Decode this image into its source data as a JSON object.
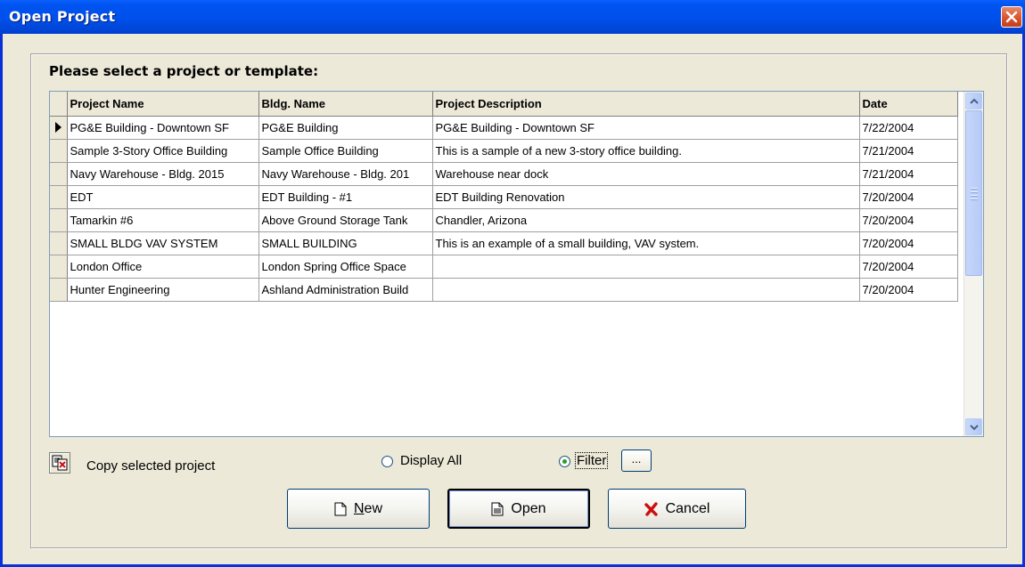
{
  "window": {
    "title": "Open Project"
  },
  "prompt": "Please select a project or template:",
  "grid": {
    "columns": [
      "Project Name",
      "Bldg. Name",
      "Project Description",
      "Date"
    ],
    "rows": [
      [
        "PG&E Building - Downtown SF",
        "PG&E Building",
        "PG&E Building - Downtown SF",
        "7/22/2004"
      ],
      [
        "Sample 3-Story Office Building",
        "Sample Office Building",
        "This is a sample of a new 3-story office building.",
        "7/21/2004"
      ],
      [
        "Navy Warehouse - Bldg. 2015",
        "Navy Warehouse - Bldg. 201",
        "Warehouse near dock",
        "7/21/2004"
      ],
      [
        "EDT",
        "EDT Building - #1",
        "EDT Building Renovation",
        "7/20/2004"
      ],
      [
        "Tamarkin #6",
        "Above Ground Storage Tank",
        "Chandler, Arizona",
        "7/20/2004"
      ],
      [
        "SMALL BLDG VAV SYSTEM",
        "SMALL BUILDING",
        "This is an example of a small building, VAV system.",
        "7/20/2004"
      ],
      [
        "London Office",
        "London Spring Office Space",
        "",
        "7/20/2004"
      ],
      [
        "Hunter Engineering",
        "Ashland Administration Build",
        "",
        "7/20/2004"
      ]
    ],
    "selected_row": 0
  },
  "copy": {
    "label": "Copy selected project"
  },
  "options": {
    "display_all_label": "Display All",
    "filter_label": "Filter",
    "selected": "filter",
    "filter_button_label": "..."
  },
  "buttons": {
    "new_mnemonic": "N",
    "new_rest": "ew",
    "open_label": "Open",
    "cancel_label": "Cancel"
  },
  "colors": {
    "titlebar": "#0053ee",
    "close_button": "#d6502b",
    "cancel_icon": "#cc1010"
  }
}
